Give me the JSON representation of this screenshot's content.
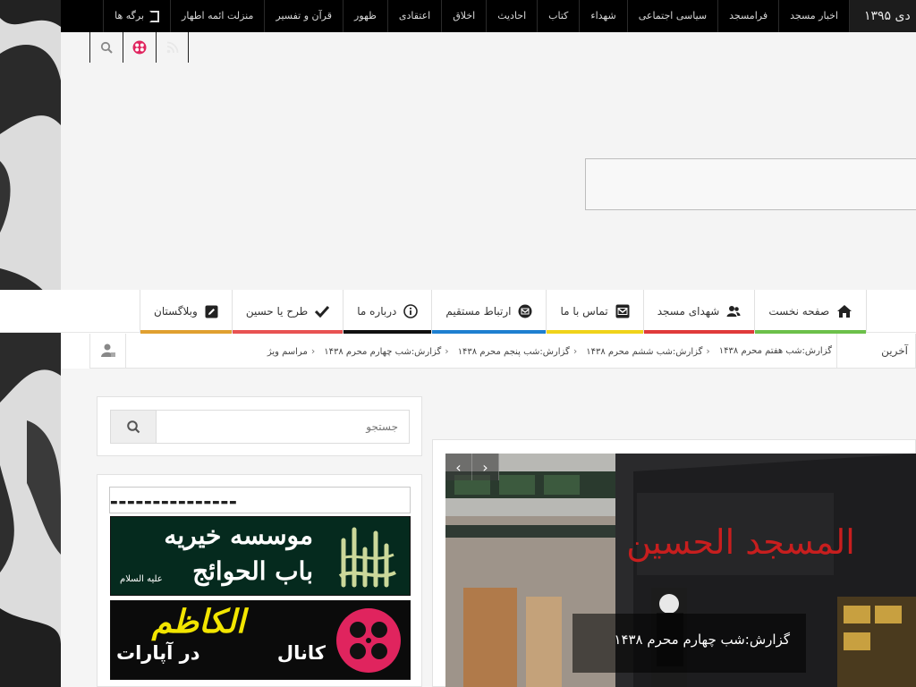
{
  "topbar": {
    "date": "دی ۱۳۹۵",
    "nav": [
      {
        "label": "اخبار مسجد"
      },
      {
        "label": "فرامسجد"
      },
      {
        "label": "سیاسی اجتماعی"
      },
      {
        "label": "شهداء"
      },
      {
        "label": "کتاب"
      },
      {
        "label": "احادیث"
      },
      {
        "label": "اخلاق"
      },
      {
        "label": "اعتقادی"
      },
      {
        "label": "ظهور"
      },
      {
        "label": "قرآن و تفسیر"
      },
      {
        "label": "منزلت ائمه اطهار"
      }
    ],
    "pages_label": "برگه ها"
  },
  "social_icons": [
    "search-icon",
    "aparat-icon",
    "rss-icon"
  ],
  "main_nav": [
    {
      "label": "صفحه نخست",
      "icon": "home-icon",
      "color": "#6cc04a"
    },
    {
      "label": "شهدای مسجد",
      "icon": "users-icon",
      "color": "#e03a3a"
    },
    {
      "label": "تماس با ما",
      "icon": "mail-icon",
      "color": "#f0d31a"
    },
    {
      "label": "ارتباط مستقیم",
      "icon": "chat-icon",
      "color": "#1e7fd0"
    },
    {
      "label": "درباره ما",
      "icon": "info-icon",
      "color": "#111111"
    },
    {
      "label": "طرح یا حسین",
      "icon": "check-icon",
      "color": "#e85252"
    },
    {
      "label": "وبلاگستان",
      "icon": "edit-icon",
      "color": "#e0a030"
    }
  ],
  "ticker": {
    "label": "آخرین",
    "items": [
      "گزارش:شب هفتم محرم ۱۴۳۸",
      "گزارش:شب ششم محرم ۱۴۳۸",
      "گزارش:شب پنجم محرم ۱۴۳۸",
      "گزارش:شب چهارم محرم ۱۴۳۸",
      "مراسم ویژ"
    ]
  },
  "search": {
    "placeholder": "جستجو"
  },
  "ads": {
    "top_text": "▬▬▬▬▬▬▬▬▬▬▬▬▬▬▬",
    "banner1": {
      "line1": "موسسه خیریه",
      "line2": "باب الحوائج",
      "line3": "علیه السلام"
    },
    "banner2": {
      "line1": "کانال",
      "line2": "الکاظم",
      "line3": "در آپارات"
    }
  },
  "slider": {
    "caption": "گزارش:شب چهارم محرم ۱۴۳۸",
    "banner_text": "المسجد الحسین",
    "prev_label": "‹",
    "next_label": "›"
  }
}
